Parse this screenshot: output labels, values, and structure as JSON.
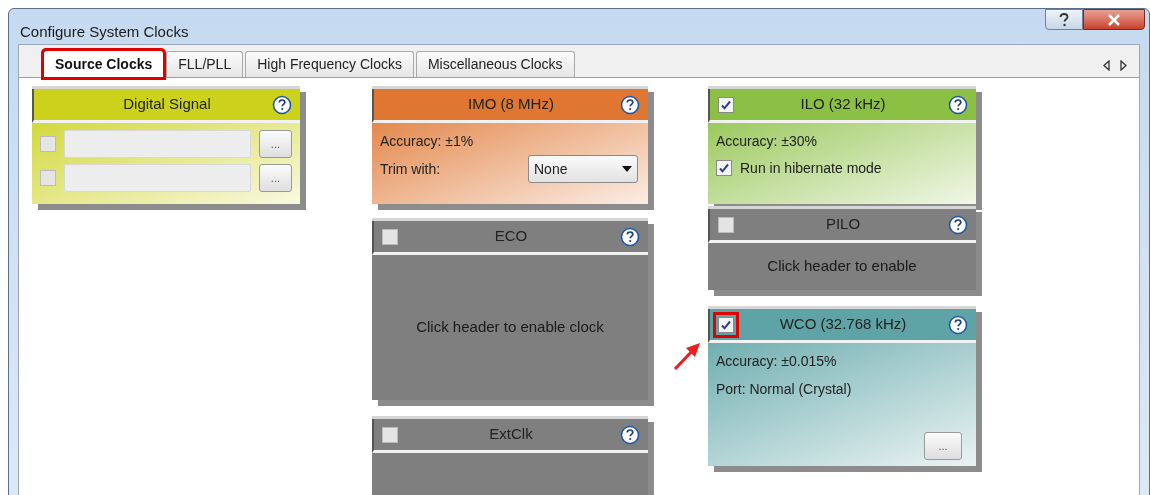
{
  "window": {
    "title": "Configure System Clocks"
  },
  "tabs": [
    {
      "label": "Source Clocks",
      "selected": true,
      "highlighted": true
    },
    {
      "label": "FLL/PLL",
      "selected": false,
      "highlighted": false
    },
    {
      "label": "High Frequency Clocks",
      "selected": false,
      "highlighted": false
    },
    {
      "label": "Miscellaneous Clocks",
      "selected": false,
      "highlighted": false
    }
  ],
  "columns": [
    [
      {
        "title": "Digital Signal",
        "color": "#ccd21c",
        "enabled": true,
        "body": [
          {
            "kind": "signal_row",
            "checked": false,
            "button": "..."
          },
          {
            "kind": "signal_row",
            "checked": false,
            "button": "..."
          }
        ]
      }
    ],
    [
      {
        "title": "IMO (8 MHz)",
        "color": "#df7631",
        "enabled": true,
        "body": [
          {
            "kind": "text",
            "text": "Accuracy: ±1%"
          },
          {
            "kind": "dropdown",
            "label": "Trim with:",
            "value": "None"
          }
        ]
      },
      {
        "title": "ECO",
        "color": "#7f7f7f",
        "enabled": false,
        "checked": false,
        "highlighted": false,
        "body": [
          {
            "kind": "message",
            "text": "Click header to enable clock"
          }
        ]
      },
      {
        "title": "ExtClk",
        "color": "#7f7f7f",
        "enabled": false,
        "checked": false,
        "highlighted": false
      }
    ],
    [
      {
        "title": "ILO (32 kHz)",
        "color": "#8cc044",
        "enabled": true,
        "checked": true,
        "highlighted": false,
        "body": [
          {
            "kind": "text",
            "text": "Accuracy: ±30%"
          },
          {
            "kind": "checkbox",
            "label": "Run in hibernate mode",
            "checked": true
          }
        ]
      },
      {
        "title": "PILO",
        "color": "#7f7f7f",
        "enabled": false,
        "checked": false,
        "highlighted": false,
        "body": [
          {
            "kind": "message",
            "text": "Click header to enable"
          }
        ]
      },
      {
        "title": "WCO (32.768 kHz)",
        "color": "#5ea4a6",
        "enabled": true,
        "checked": true,
        "highlighted": true,
        "pointer_arrow": true,
        "body": [
          {
            "kind": "text",
            "text": "Accuracy: ±0.015%"
          },
          {
            "kind": "text",
            "text": "Port: Normal (Crystal)"
          },
          {
            "kind": "more_button",
            "label": "..."
          }
        ]
      }
    ]
  ]
}
